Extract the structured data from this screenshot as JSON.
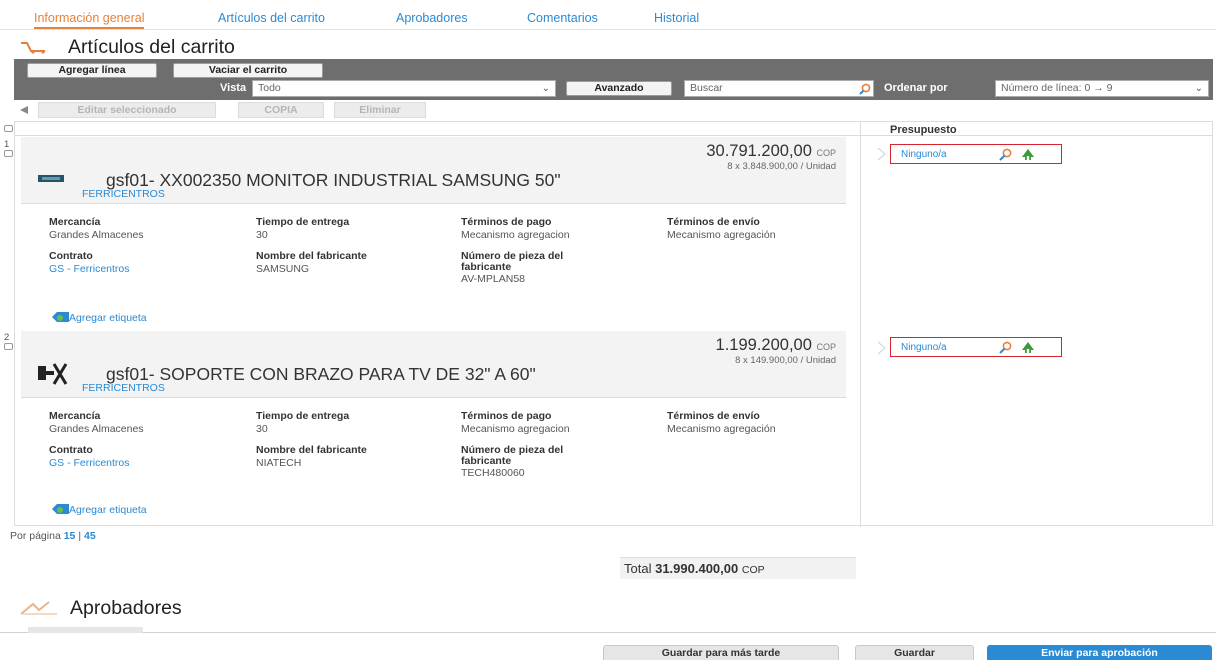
{
  "tabs": [
    {
      "label": "Información general",
      "active": true
    },
    {
      "label": "Artículos del carrito",
      "active": false
    },
    {
      "label": "Aprobadores",
      "active": false
    },
    {
      "label": "Comentarios",
      "active": false
    },
    {
      "label": "Historial",
      "active": false
    }
  ],
  "cart_section": {
    "title": "Artículos del carrito",
    "icon": "cart-icon"
  },
  "toolbar": {
    "add_line": "Agregar línea",
    "empty_cart": "Vaciar el carrito",
    "view_label": "Vista",
    "view_value": "Todo",
    "advanced": "Avanzado",
    "search_placeholder": "Buscar",
    "sort_label": "Ordenar por",
    "sort_value": "Número de línea: 0 → 9"
  },
  "actions": {
    "edit_selected": "Editar seleccionado",
    "copy": "COPIA",
    "delete": "Eliminar"
  },
  "grid": {
    "budget_header": "Presupuesto"
  },
  "items": [
    {
      "number": "1",
      "price": "30.791.200,00",
      "currency": "COP",
      "unit_price": "8 x 3.848.900,00 / Unidad",
      "title": "gsf01- XX002350 MONITOR INDUSTRIAL SAMSUNG 50\"",
      "supplier": "FERRICENTROS",
      "commodity_label": "Mercancía",
      "commodity": "Grandes Almacenes",
      "lead_time_label": "Tiempo de entrega",
      "lead_time": "30",
      "payment_terms_label": "Términos de pago",
      "payment_terms": "Mecanismo agregacion",
      "shipping_terms_label": "Términos de envío",
      "shipping_terms": "Mecanismo agregación",
      "contract_label": "Contrato",
      "contract": "GS - Ferricentros",
      "manufacturer_label": "Nombre del fabricante",
      "manufacturer": "SAMSUNG",
      "part_label_1": "Número de pieza del",
      "part_label_2": "fabricante",
      "part": "AV-MPLAN58",
      "add_tag": "Agregar etiqueta",
      "budget": "Ninguno/a"
    },
    {
      "number": "2",
      "price": "1.199.200,00",
      "currency": "COP",
      "unit_price": "8 x 149.900,00 / Unidad",
      "title": "gsf01- SOPORTE CON BRAZO PARA TV DE 32\" A 60\"",
      "supplier": "FERRICENTROS",
      "commodity_label": "Mercancía",
      "commodity": "Grandes Almacenes",
      "lead_time_label": "Tiempo de entrega",
      "lead_time": "30",
      "payment_terms_label": "Términos de pago",
      "payment_terms": "Mecanismo agregacion",
      "shipping_terms_label": "Términos de envío",
      "shipping_terms": "Mecanismo agregación",
      "contract_label": "Contrato",
      "contract": "GS - Ferricentros",
      "manufacturer_label": "Nombre del fabricante",
      "manufacturer": "NIATECH",
      "part_label_1": "Número de pieza del",
      "part_label_2": "fabricante",
      "part": "TECH480060",
      "add_tag": "Agregar etiqueta",
      "budget": "Ninguno/a"
    }
  ],
  "pagination": {
    "label": "Por página",
    "opt1": "15",
    "sep": "|",
    "opt2": "45"
  },
  "total": {
    "label": "Total",
    "value": "31.990.400,00",
    "currency": "COP"
  },
  "approvers_section": {
    "title": "Aprobadores"
  },
  "footer": {
    "save_later": "Guardar para más tarde",
    "save": "Guardar",
    "submit": "Enviar para aprobación"
  },
  "colors": {
    "accent": "#e8803a",
    "link": "#2a8ad4",
    "toolbar": "#6e6e6e",
    "budget_border": "#d9232f"
  }
}
